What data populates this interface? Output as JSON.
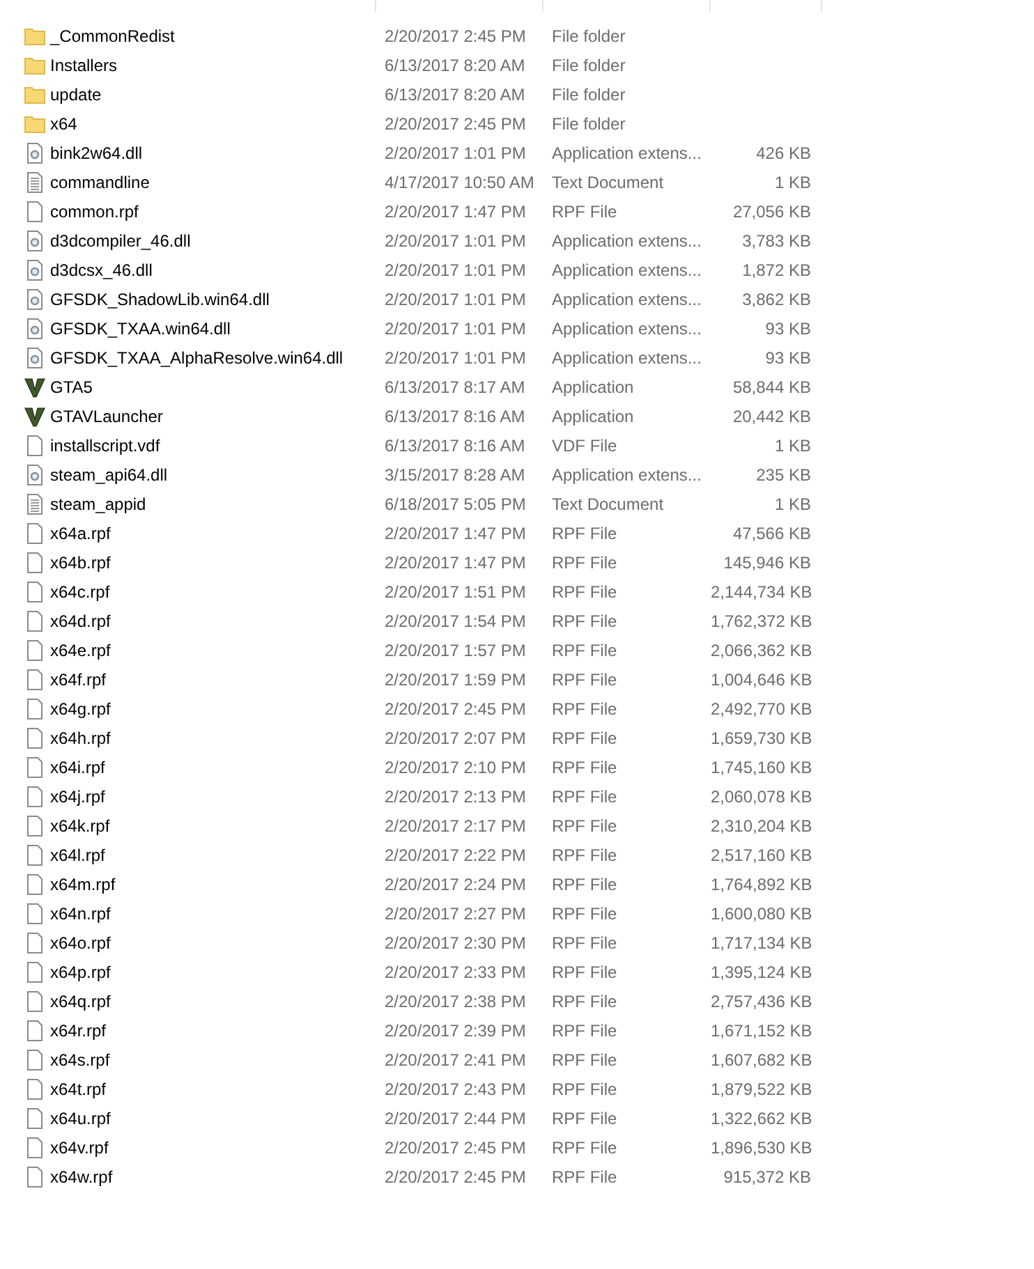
{
  "files": [
    {
      "name": "_CommonRedist",
      "date": "2/20/2017 2:45 PM",
      "type": "File folder",
      "kind": "folder"
    },
    {
      "name": "Installers",
      "date": "6/13/2017 8:20 AM",
      "type": "File folder",
      "kind": "folder"
    },
    {
      "name": "update",
      "date": "6/13/2017 8:20 AM",
      "type": "File folder",
      "kind": "folder"
    },
    {
      "name": "x64",
      "date": "2/20/2017 2:45 PM",
      "type": "File folder",
      "kind": "folder"
    },
    {
      "name": "bink2w64.dll",
      "date": "2/20/2017 1:01 PM",
      "type": "Application extens...",
      "size": "426 KB",
      "kind": "dll"
    },
    {
      "name": "commandline",
      "date": "4/17/2017 10:50 AM",
      "type": "Text Document",
      "size": "1 KB",
      "kind": "text"
    },
    {
      "name": "common.rpf",
      "date": "2/20/2017 1:47 PM",
      "type": "RPF File",
      "size": "27,056 KB",
      "kind": "blank"
    },
    {
      "name": "d3dcompiler_46.dll",
      "date": "2/20/2017 1:01 PM",
      "type": "Application extens...",
      "size": "3,783 KB",
      "kind": "dll"
    },
    {
      "name": "d3dcsx_46.dll",
      "date": "2/20/2017 1:01 PM",
      "type": "Application extens...",
      "size": "1,872 KB",
      "kind": "dll"
    },
    {
      "name": "GFSDK_ShadowLib.win64.dll",
      "date": "2/20/2017 1:01 PM",
      "type": "Application extens...",
      "size": "3,862 KB",
      "kind": "dll"
    },
    {
      "name": "GFSDK_TXAA.win64.dll",
      "date": "2/20/2017 1:01 PM",
      "type": "Application extens...",
      "size": "93 KB",
      "kind": "dll"
    },
    {
      "name": "GFSDK_TXAA_AlphaResolve.win64.dll",
      "date": "2/20/2017 1:01 PM",
      "type": "Application extens...",
      "size": "93 KB",
      "kind": "dll"
    },
    {
      "name": "GTA5",
      "date": "6/13/2017 8:17 AM",
      "type": "Application",
      "size": "58,844 KB",
      "kind": "app"
    },
    {
      "name": "GTAVLauncher",
      "date": "6/13/2017 8:16 AM",
      "type": "Application",
      "size": "20,442 KB",
      "kind": "app"
    },
    {
      "name": "installscript.vdf",
      "date": "6/13/2017 8:16 AM",
      "type": "VDF File",
      "size": "1 KB",
      "kind": "blank"
    },
    {
      "name": "steam_api64.dll",
      "date": "3/15/2017 8:28 AM",
      "type": "Application extens...",
      "size": "235 KB",
      "kind": "dll"
    },
    {
      "name": "steam_appid",
      "date": "6/18/2017 5:05 PM",
      "type": "Text Document",
      "size": "1 KB",
      "kind": "text"
    },
    {
      "name": "x64a.rpf",
      "date": "2/20/2017 1:47 PM",
      "type": "RPF File",
      "size": "47,566 KB",
      "kind": "blank"
    },
    {
      "name": "x64b.rpf",
      "date": "2/20/2017 1:47 PM",
      "type": "RPF File",
      "size": "145,946 KB",
      "kind": "blank"
    },
    {
      "name": "x64c.rpf",
      "date": "2/20/2017 1:51 PM",
      "type": "RPF File",
      "size": "2,144,734 KB",
      "kind": "blank"
    },
    {
      "name": "x64d.rpf",
      "date": "2/20/2017 1:54 PM",
      "type": "RPF File",
      "size": "1,762,372 KB",
      "kind": "blank"
    },
    {
      "name": "x64e.rpf",
      "date": "2/20/2017 1:57 PM",
      "type": "RPF File",
      "size": "2,066,362 KB",
      "kind": "blank"
    },
    {
      "name": "x64f.rpf",
      "date": "2/20/2017 1:59 PM",
      "type": "RPF File",
      "size": "1,004,646 KB",
      "kind": "blank"
    },
    {
      "name": "x64g.rpf",
      "date": "2/20/2017 2:45 PM",
      "type": "RPF File",
      "size": "2,492,770 KB",
      "kind": "blank"
    },
    {
      "name": "x64h.rpf",
      "date": "2/20/2017 2:07 PM",
      "type": "RPF File",
      "size": "1,659,730 KB",
      "kind": "blank"
    },
    {
      "name": "x64i.rpf",
      "date": "2/20/2017 2:10 PM",
      "type": "RPF File",
      "size": "1,745,160 KB",
      "kind": "blank"
    },
    {
      "name": "x64j.rpf",
      "date": "2/20/2017 2:13 PM",
      "type": "RPF File",
      "size": "2,060,078 KB",
      "kind": "blank"
    },
    {
      "name": "x64k.rpf",
      "date": "2/20/2017 2:17 PM",
      "type": "RPF File",
      "size": "2,310,204 KB",
      "kind": "blank"
    },
    {
      "name": "x64l.rpf",
      "date": "2/20/2017 2:22 PM",
      "type": "RPF File",
      "size": "2,517,160 KB",
      "kind": "blank"
    },
    {
      "name": "x64m.rpf",
      "date": "2/20/2017 2:24 PM",
      "type": "RPF File",
      "size": "1,764,892 KB",
      "kind": "blank"
    },
    {
      "name": "x64n.rpf",
      "date": "2/20/2017 2:27 PM",
      "type": "RPF File",
      "size": "1,600,080 KB",
      "kind": "blank"
    },
    {
      "name": "x64o.rpf",
      "date": "2/20/2017 2:30 PM",
      "type": "RPF File",
      "size": "1,717,134 KB",
      "kind": "blank"
    },
    {
      "name": "x64p.rpf",
      "date": "2/20/2017 2:33 PM",
      "type": "RPF File",
      "size": "1,395,124 KB",
      "kind": "blank"
    },
    {
      "name": "x64q.rpf",
      "date": "2/20/2017 2:38 PM",
      "type": "RPF File",
      "size": "2,757,436 KB",
      "kind": "blank"
    },
    {
      "name": "x64r.rpf",
      "date": "2/20/2017 2:39 PM",
      "type": "RPF File",
      "size": "1,671,152 KB",
      "kind": "blank"
    },
    {
      "name": "x64s.rpf",
      "date": "2/20/2017 2:41 PM",
      "type": "RPF File",
      "size": "1,607,682 KB",
      "kind": "blank"
    },
    {
      "name": "x64t.rpf",
      "date": "2/20/2017 2:43 PM",
      "type": "RPF File",
      "size": "1,879,522 KB",
      "kind": "blank"
    },
    {
      "name": "x64u.rpf",
      "date": "2/20/2017 2:44 PM",
      "type": "RPF File",
      "size": "1,322,662 KB",
      "kind": "blank"
    },
    {
      "name": "x64v.rpf",
      "date": "2/20/2017 2:45 PM",
      "type": "RPF File",
      "size": "1,896,530 KB",
      "kind": "blank"
    },
    {
      "name": "x64w.rpf",
      "date": "2/20/2017 2:45 PM",
      "type": "RPF File",
      "size": "915,372 KB",
      "kind": "blank"
    }
  ]
}
